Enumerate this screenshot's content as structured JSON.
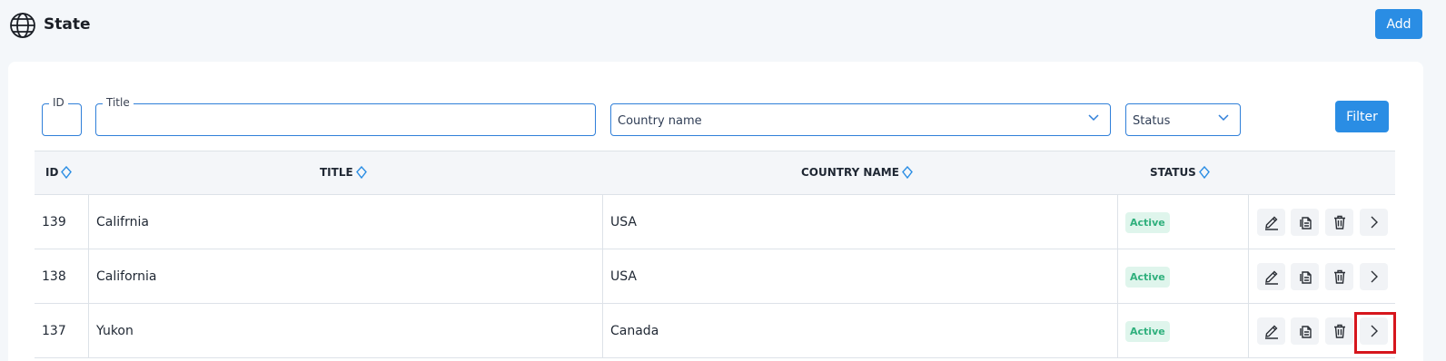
{
  "header": {
    "title": "State",
    "icon": "globe-icon",
    "add_label": "Add"
  },
  "filters": {
    "id_label": "ID",
    "title_label": "Title",
    "country_placeholder": "Country name",
    "status_placeholder": "Status",
    "filter_label": "Filter"
  },
  "table": {
    "columns": [
      "ID",
      "TITLE",
      "COUNTRY NAME",
      "STATUS"
    ],
    "rows": [
      {
        "id": "139",
        "title": "Califrnia",
        "country": "USA",
        "status": "Active"
      },
      {
        "id": "138",
        "title": "California",
        "country": "USA",
        "status": "Active"
      },
      {
        "id": "137",
        "title": "Yukon",
        "country": "Canada",
        "status": "Active"
      }
    ],
    "actions": [
      "edit-icon",
      "copy-icon",
      "trash-icon",
      "chevron-right-icon"
    ]
  },
  "colors": {
    "accent": "#2a8de4",
    "active_badge_bg": "#dff5ec",
    "active_badge_text": "#30b07d",
    "highlight": "#d6161d"
  }
}
